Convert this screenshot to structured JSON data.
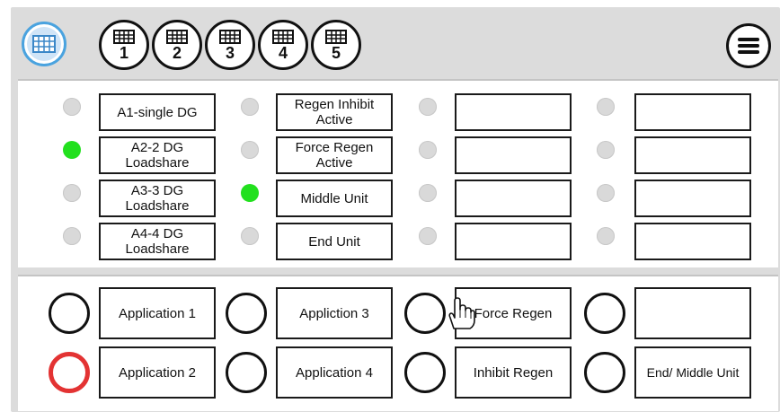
{
  "toolbar": {
    "home_icon": "grid-icon",
    "tabs": [
      {
        "label": "1",
        "icon": "grid-icon"
      },
      {
        "label": "2",
        "icon": "grid-icon"
      },
      {
        "label": "3",
        "icon": "grid-icon"
      },
      {
        "label": "4",
        "icon": "grid-icon"
      },
      {
        "label": "5",
        "icon": "grid-icon"
      }
    ],
    "menu_icon": "hamburger-icon"
  },
  "status_panel": {
    "columns": [
      {
        "rows": [
          {
            "label": "A1-single DG",
            "active": false
          },
          {
            "label": "A2-2 DG Loadshare",
            "active": true
          },
          {
            "label": "A3-3 DG Loadshare",
            "active": false
          },
          {
            "label": "A4-4 DG Loadshare",
            "active": false
          }
        ]
      },
      {
        "rows": [
          {
            "label": "Regen Inhibit Active",
            "active": false
          },
          {
            "label": "Force Regen Active",
            "active": false
          },
          {
            "label": "Middle Unit",
            "active": true
          },
          {
            "label": "End Unit",
            "active": false
          }
        ]
      },
      {
        "rows": [
          {
            "label": "",
            "active": false
          },
          {
            "label": "",
            "active": false
          },
          {
            "label": "",
            "active": false
          },
          {
            "label": "",
            "active": false
          }
        ]
      },
      {
        "rows": [
          {
            "label": "",
            "active": false
          },
          {
            "label": "",
            "active": false
          },
          {
            "label": "",
            "active": false
          },
          {
            "label": "",
            "active": false
          }
        ]
      }
    ]
  },
  "application_panel": {
    "buttons": [
      {
        "label": "Application 1",
        "selected": false
      },
      {
        "label": "Application 2",
        "selected": true
      },
      {
        "label": "Appliction 3",
        "selected": false
      },
      {
        "label": "Application 4",
        "selected": false
      },
      {
        "label": "Force Regen",
        "selected": false
      },
      {
        "label": "Inhibit Regen",
        "selected": false
      },
      {
        "label": "",
        "selected": false
      },
      {
        "label": "End/ Middle Unit",
        "selected": false
      }
    ]
  },
  "colors": {
    "led_on": "#22e01e",
    "led_off": "#d9d9d9",
    "selected_ring": "#e33333",
    "home_ring": "#4aa3df"
  }
}
